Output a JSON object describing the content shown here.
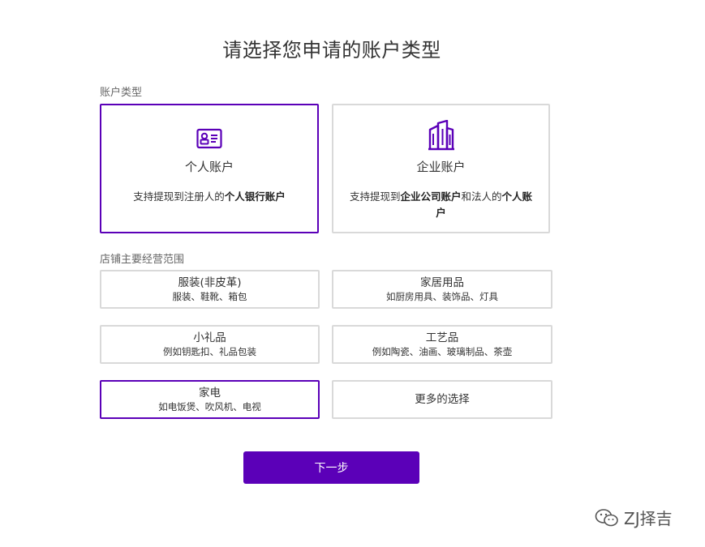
{
  "page": {
    "title": "请选择您申请的账户类型"
  },
  "account_section": {
    "label": "账户类型",
    "cards": [
      {
        "name": "个人账户",
        "desc_prefix": "支持提现到注册人的",
        "desc_bold": "个人银行账户",
        "icon": "id-card-icon",
        "selected": true
      },
      {
        "name": "企业账户",
        "desc_prefix": "支持提现到",
        "desc_bold": "企业公司账户",
        "desc_mid": "和法人的",
        "desc_bold2": "个人账户",
        "icon": "building-icon",
        "selected": false
      }
    ]
  },
  "category_section": {
    "label": "店铺主要经营范围",
    "items": [
      {
        "name": "服装(非皮革)",
        "sub": "服装、鞋靴、箱包",
        "selected": false
      },
      {
        "name": "家居用品",
        "sub": "如厨房用具、装饰品、灯具",
        "selected": false
      },
      {
        "name": "小礼品",
        "sub": "例如钥匙扣、礼品包装",
        "selected": false
      },
      {
        "name": "工艺品",
        "sub": "例如陶瓷、油画、玻璃制品、茶壶",
        "selected": false
      },
      {
        "name": "家电",
        "sub": "如电饭煲、吹风机、电视",
        "selected": true
      },
      {
        "name": "更多的选择",
        "sub": "",
        "selected": false
      }
    ]
  },
  "actions": {
    "next_label": "下一步"
  },
  "watermark": {
    "text": "ZJ择吉"
  },
  "colors": {
    "accent": "#5b00b8",
    "border": "#d9d9d9"
  }
}
